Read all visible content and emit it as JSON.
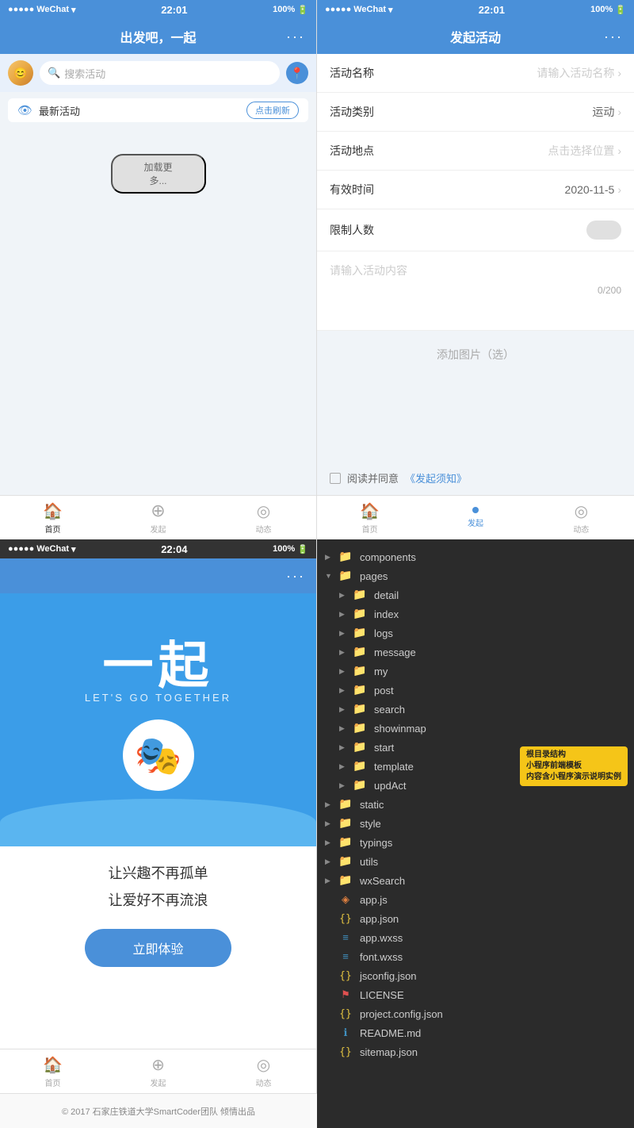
{
  "left_phone": {
    "status_bar": {
      "carrier": "WeChat",
      "time": "22:01",
      "battery": "100%"
    },
    "header": {
      "title": "出发吧，一起",
      "dots": "···"
    },
    "search": {
      "placeholder": "搜索活动"
    },
    "activity_section": {
      "label": "最新活动",
      "refresh_btn": "点击刷新",
      "load_more": "加载更多..."
    },
    "nav": {
      "items": [
        {
          "icon": "🏠",
          "label": "首页",
          "active": true
        },
        {
          "icon": "⊕",
          "label": "发起",
          "active": false
        },
        {
          "icon": "◎",
          "label": "动态",
          "active": false
        }
      ]
    }
  },
  "right_phone": {
    "status_bar": {
      "carrier": "WeChat",
      "time": "22:01",
      "battery": "100%"
    },
    "header": {
      "title": "发起活动",
      "dots": "···"
    },
    "form": {
      "fields": [
        {
          "label": "活动名称",
          "value": "请输入活动名称",
          "has_value": false
        },
        {
          "label": "活动类别",
          "value": "运动",
          "has_value": true
        },
        {
          "label": "活动地点",
          "value": "点击选择位置",
          "has_value": false
        },
        {
          "label": "有效时间",
          "value": "2020-11-5",
          "has_value": true
        },
        {
          "label": "限制人数",
          "value": "",
          "is_toggle": true
        }
      ],
      "textarea_placeholder": "请输入活动内容",
      "char_count": "0/200",
      "add_image": "添加图片（选）"
    },
    "agree": {
      "text": "阅读并同意",
      "link": "《发起须知》"
    },
    "nav": {
      "items": [
        {
          "icon": "🏠",
          "label": "首页",
          "active": false
        },
        {
          "icon": "●",
          "label": "发起",
          "active": true
        },
        {
          "icon": "◎",
          "label": "动态",
          "active": false
        }
      ]
    }
  },
  "third_phone": {
    "status_bar": {
      "carrier": "WeChat",
      "time": "22:04",
      "battery": "100%"
    },
    "header": {
      "dots": "···"
    },
    "hero": {
      "chinese_big": "一起",
      "english_sub": "LET'S GO TOGETHER"
    },
    "slogans": {
      "line1": "让兴趣不再孤单",
      "line2": "让爱好不再流浪"
    },
    "cta_btn": "立即体验",
    "nav": {
      "items": [
        {
          "icon": "🏠",
          "label": "首页",
          "active": false
        },
        {
          "icon": "⊕",
          "label": "发起",
          "active": false
        },
        {
          "icon": "◎",
          "label": "动态",
          "active": false
        }
      ]
    },
    "footer": "© 2017 石家庄铁道大学SmartCoder团队 倾情出品"
  },
  "file_tree": {
    "items": [
      {
        "indent": 0,
        "arrow": "▶",
        "icon": "📁",
        "icon_color": "yellow",
        "label": "components",
        "type": "folder"
      },
      {
        "indent": 0,
        "arrow": "▼",
        "icon": "📁",
        "icon_color": "red",
        "label": "pages",
        "type": "folder"
      },
      {
        "indent": 1,
        "arrow": "▶",
        "icon": "📁",
        "icon_color": "blue-dark",
        "label": "detail",
        "type": "folder"
      },
      {
        "indent": 1,
        "arrow": "▶",
        "icon": "📁",
        "icon_color": "blue-dark",
        "label": "index",
        "type": "folder"
      },
      {
        "indent": 1,
        "arrow": "▶",
        "icon": "📁",
        "icon_color": "yellow",
        "label": "logs",
        "type": "folder"
      },
      {
        "indent": 1,
        "arrow": "▶",
        "icon": "📁",
        "icon_color": "blue-dark",
        "label": "message",
        "type": "folder"
      },
      {
        "indent": 1,
        "arrow": "▶",
        "icon": "📁",
        "icon_color": "blue-dark",
        "label": "my",
        "type": "folder"
      },
      {
        "indent": 1,
        "arrow": "▶",
        "icon": "📁",
        "icon_color": "blue",
        "label": "post",
        "type": "folder"
      },
      {
        "indent": 1,
        "arrow": "▶",
        "icon": "📁",
        "icon_color": "blue-dark",
        "label": "search",
        "type": "folder",
        "annotation": null
      },
      {
        "indent": 1,
        "arrow": "▶",
        "icon": "📁",
        "icon_color": "blue-dark",
        "label": "showinmap",
        "type": "folder"
      },
      {
        "indent": 1,
        "arrow": "▶",
        "icon": "📁",
        "icon_color": "blue-dark",
        "label": "start",
        "type": "folder"
      },
      {
        "indent": 1,
        "arrow": "▶",
        "icon": "📁",
        "icon_color": "red",
        "label": "template",
        "type": "folder",
        "annotation": {
          "line1": "根目录结构",
          "line2": "小程序前端模板",
          "line3": "内容含小程序演示说明实例"
        }
      },
      {
        "indent": 1,
        "arrow": "▶",
        "icon": "📁",
        "icon_color": "blue-dark",
        "label": "updAct",
        "type": "folder"
      },
      {
        "indent": 0,
        "arrow": "▶",
        "icon": "📁",
        "icon_color": "blue-dark",
        "label": "static",
        "type": "folder"
      },
      {
        "indent": 0,
        "arrow": "▶",
        "icon": "📁",
        "icon_color": "blue-dark",
        "label": "style",
        "type": "folder"
      },
      {
        "indent": 0,
        "arrow": "▶",
        "icon": "📁",
        "icon_color": "blue-dark",
        "label": "typings",
        "type": "folder"
      },
      {
        "indent": 0,
        "arrow": "▶",
        "icon": "📁",
        "icon_color": "blue-dark",
        "label": "utils",
        "type": "folder"
      },
      {
        "indent": 0,
        "arrow": "▶",
        "icon": "📁",
        "icon_color": "blue-dark",
        "label": "wxSearch",
        "type": "folder"
      },
      {
        "indent": 0,
        "arrow": "",
        "icon": "🟧",
        "icon_color": "orange",
        "label": "app.js",
        "type": "file"
      },
      {
        "indent": 0,
        "arrow": "",
        "icon": "🟨",
        "icon_color": "json",
        "label": "app.json",
        "type": "file"
      },
      {
        "indent": 0,
        "arrow": "",
        "icon": "🟦",
        "icon_color": "wxss",
        "label": "app.wxss",
        "type": "file"
      },
      {
        "indent": 0,
        "arrow": "",
        "icon": "🟦",
        "icon_color": "wxss",
        "label": "font.wxss",
        "type": "file"
      },
      {
        "indent": 0,
        "arrow": "",
        "icon": "🟨",
        "icon_color": "json",
        "label": "jsconfig.json",
        "type": "file"
      },
      {
        "indent": 0,
        "arrow": "",
        "icon": "🟥",
        "icon_color": "license",
        "label": "LICENSE",
        "type": "file"
      },
      {
        "indent": 0,
        "arrow": "",
        "icon": "🟨",
        "icon_color": "json",
        "label": "project.config.json",
        "type": "file"
      },
      {
        "indent": 0,
        "arrow": "",
        "icon": "🔵",
        "icon_color": "readme",
        "label": "README.md",
        "type": "file"
      },
      {
        "indent": 0,
        "arrow": "",
        "icon": "🟨",
        "icon_color": "json",
        "label": "sitemap.json",
        "type": "file"
      }
    ]
  }
}
